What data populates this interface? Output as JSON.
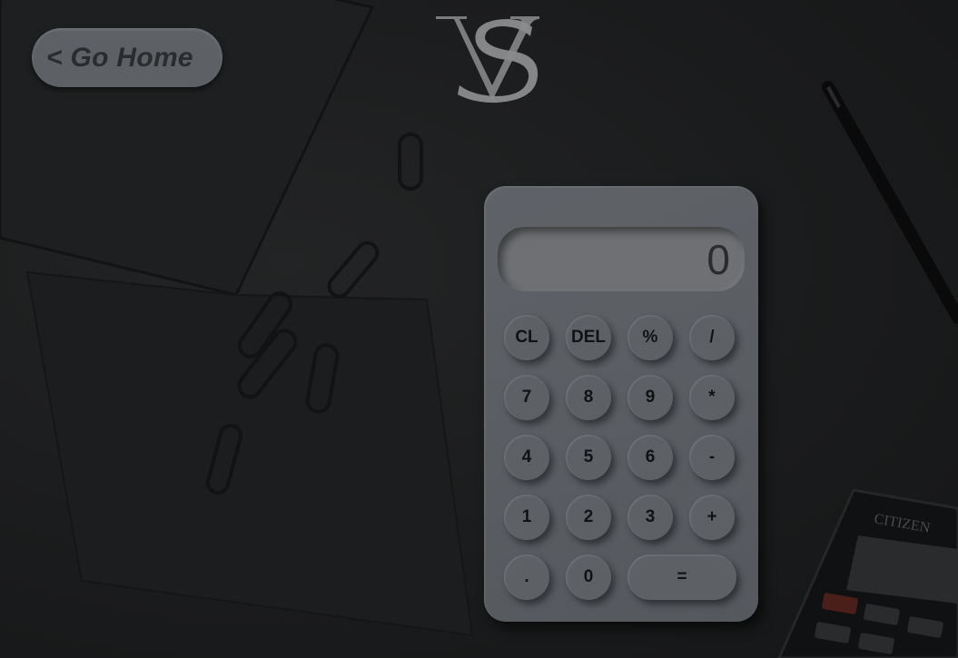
{
  "nav": {
    "home_label": "< Go Home"
  },
  "calculator": {
    "display_value": "0",
    "rows": [
      [
        "CL",
        "DEL",
        "%",
        "/"
      ],
      [
        "7",
        "8",
        "9",
        "*"
      ],
      [
        "4",
        "5",
        "6",
        "-"
      ],
      [
        "1",
        "2",
        "3",
        "+"
      ],
      [
        ".",
        "0",
        "="
      ]
    ]
  },
  "background": {
    "calculator_brand": "CITIZEN"
  },
  "colors": {
    "background": "#1b1c1d",
    "calculator_body": "#5d6166",
    "display": "#6e7073",
    "key_text": "#111214"
  }
}
